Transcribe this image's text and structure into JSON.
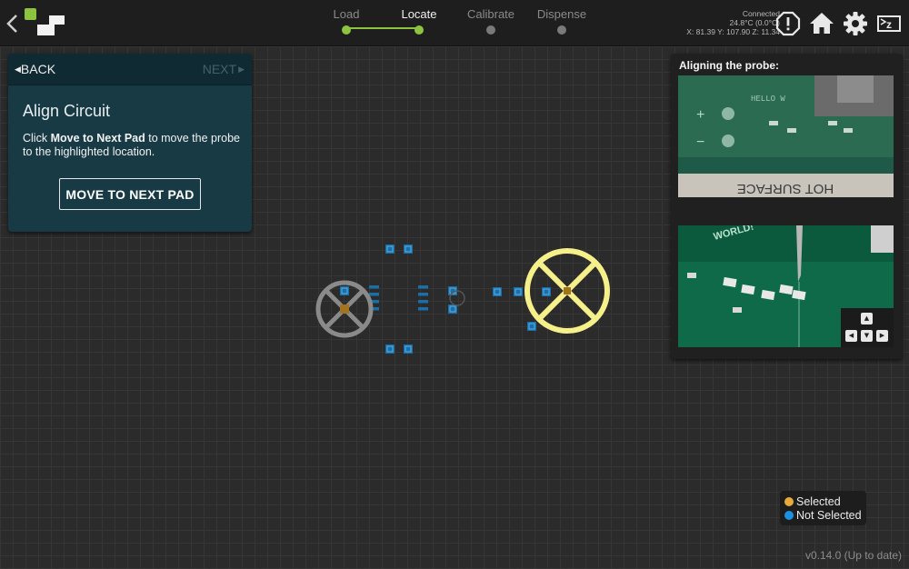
{
  "header": {
    "steps": [
      {
        "label": "Load",
        "state": "done"
      },
      {
        "label": "Locate",
        "state": "active"
      },
      {
        "label": "Calibrate",
        "state": "pending"
      },
      {
        "label": "Dispense",
        "state": "pending"
      }
    ],
    "status": {
      "connection": "Connected",
      "temperature": "24.8°C (0.0°C)",
      "position": "X: 81.39 Y: 107.90 Z: 11.34"
    },
    "icons": [
      "back-chevron-icon",
      "logo",
      "alert-icon",
      "home-icon",
      "gear-icon",
      "sleep-icon"
    ]
  },
  "instructions": {
    "back_label": "BACK",
    "next_label": "NEXT",
    "title": "Align Circuit",
    "text_pre": "Click ",
    "text_bold": "Move to Next Pad",
    "text_post": " to move the probe to the highlighted location.",
    "button_label": "MOVE TO NEXT PAD"
  },
  "camera": {
    "title": "Aligning the probe:",
    "image1_text": [
      "HELLO W",
      "HOT SURFACE"
    ],
    "image2_text": [
      "WORLD!"
    ],
    "jog_buttons": [
      "up",
      "left",
      "down",
      "right"
    ]
  },
  "legend": {
    "selected_label": "Selected",
    "not_selected_label": "Not Selected",
    "selected_color": "#e8a93a",
    "not_selected_color": "#1e90e0"
  },
  "colors": {
    "accent_green": "#8cc43f",
    "pad_blue": "#1a6fa8",
    "target_yellow": "#f5f08a",
    "panel_teal": "#173a45"
  },
  "version": "v0.14.0 (Up to date)"
}
